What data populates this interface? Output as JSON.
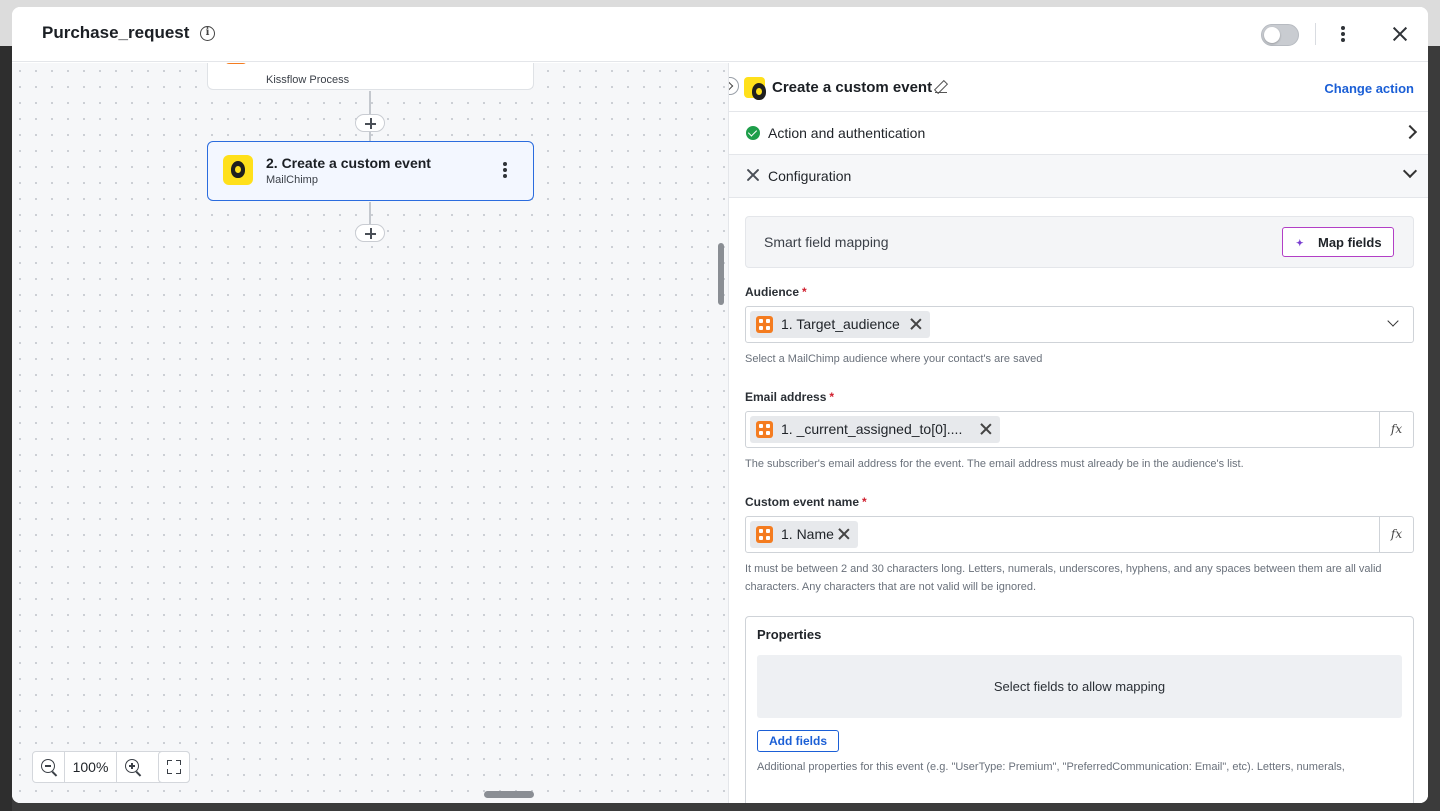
{
  "header": {
    "title": "Purchase_request"
  },
  "canvas": {
    "nodes": [
      {
        "title": "",
        "app": "Kissflow Process"
      },
      {
        "title": "2. Create a custom event",
        "app": "MailChimp"
      }
    ],
    "zoom": "100%"
  },
  "panel": {
    "title": "Create a custom event",
    "change_action": "Change action",
    "sections": {
      "auth": "Action and authentication",
      "config": "Configuration"
    },
    "smart_mapping": {
      "label": "Smart field mapping",
      "button": "Map fields"
    },
    "fields": {
      "audience": {
        "label": "Audience",
        "required": "*",
        "chip": "1. Target_audience",
        "help": "Select a MailChimp audience where your contact's are saved"
      },
      "email": {
        "label": "Email address",
        "required": "*",
        "chip": "1. _current_assigned_to[0]....",
        "help": "The subscriber's email address for the event. The email address must already be in the audience's list."
      },
      "event_name": {
        "label": "Custom event name",
        "required": "*",
        "chip": "1. Name",
        "help_line1": "It must be between 2 and 30 characters long. Letters, numerals, underscores, hyphens, and any spaces between them are all valid",
        "help_line2": "characters. Any characters that are not valid will be ignored."
      },
      "fx_label": "fx"
    },
    "properties": {
      "title": "Properties",
      "empty": "Select fields to allow mapping",
      "add_button": "Add fields",
      "help": "Additional properties for this event (e.g. \"UserType: Premium\", \"PreferredCommunication: Email\", etc). Letters, numerals,"
    }
  },
  "colors": {
    "accent": "#1b5fd6",
    "selected_border": "#2b6cde",
    "success": "#1e9e4a",
    "required": "#d0202f",
    "kissflow": "#f47c20",
    "mailchimp": "#ffe01b",
    "map_fields_border": "#b23fc6"
  }
}
